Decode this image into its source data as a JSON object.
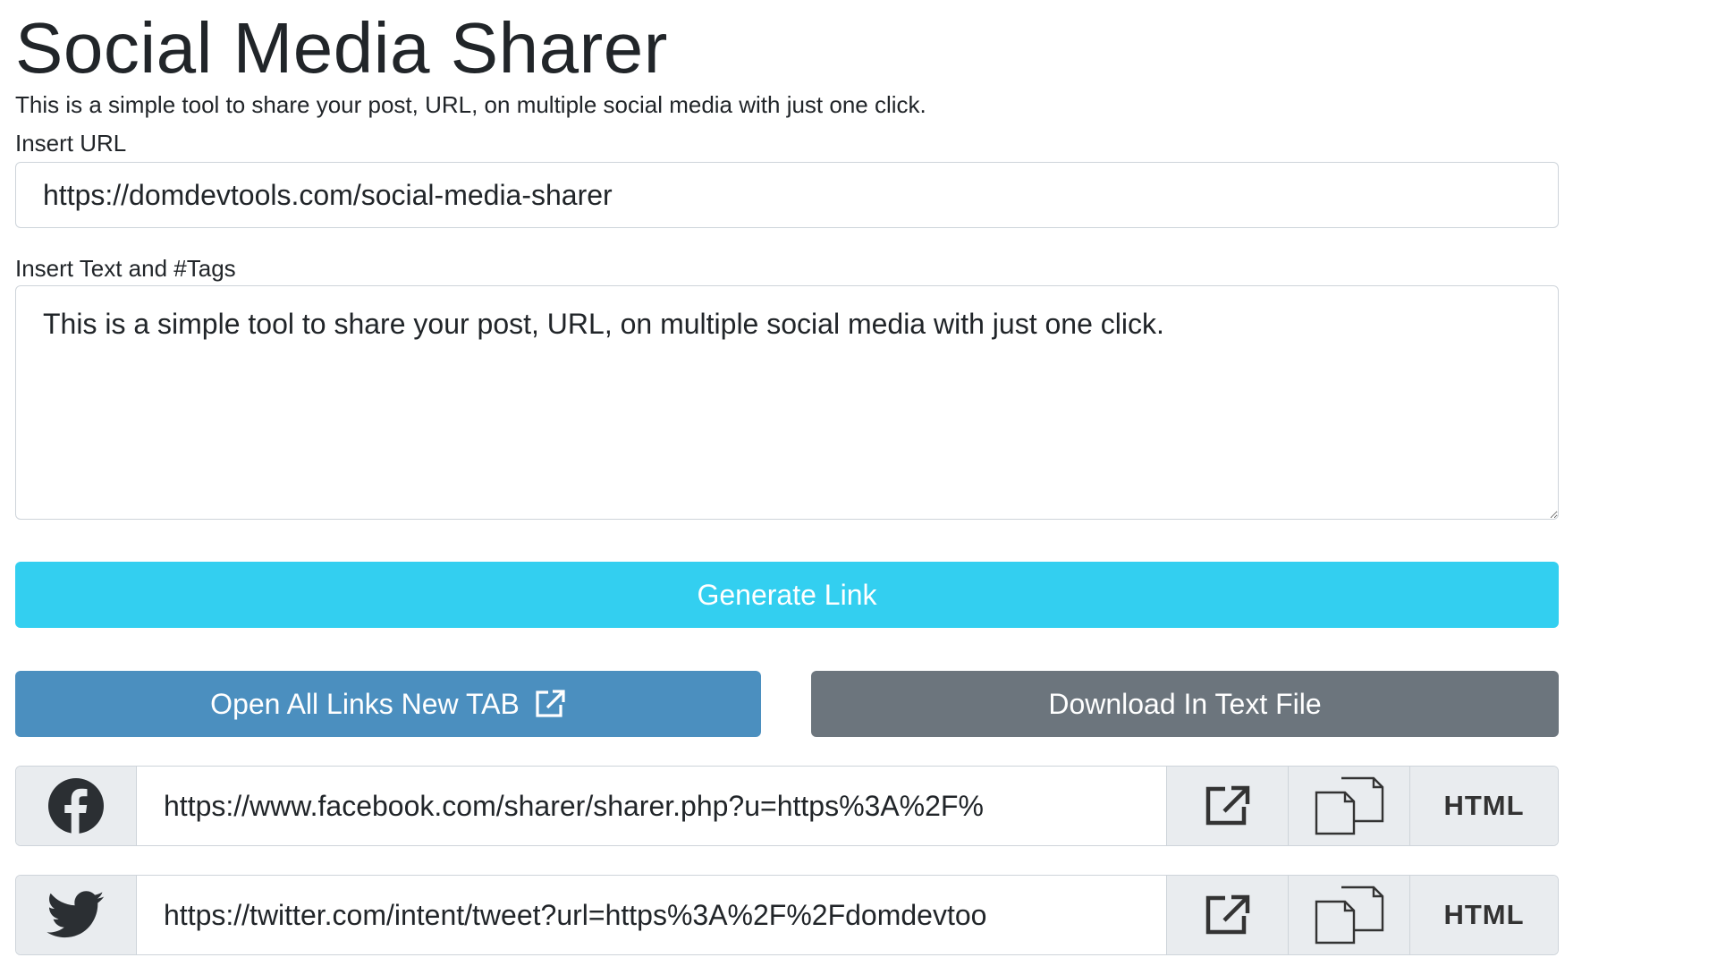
{
  "page": {
    "title": "Social Media Sharer",
    "description": "This is a simple tool to share your post, URL, on multiple social media with just one click."
  },
  "form": {
    "url_label": "Insert URL",
    "url_value": "https://domdevtools.com/social-media-sharer",
    "text_label": "Insert Text and #Tags",
    "text_value": "This is a simple tool to share your post, URL, on multiple social media with just one click."
  },
  "actions": {
    "generate_label": "Generate Link",
    "open_all_label": "Open All Links New TAB",
    "download_label": "Download In Text File"
  },
  "shares": [
    {
      "network": "facebook",
      "icon": "facebook-icon",
      "link": "https://www.facebook.com/sharer/sharer.php?u=https%3A%2F%",
      "html_label": "HTML"
    },
    {
      "network": "twitter",
      "icon": "twitter-icon",
      "link": "https://twitter.com/intent/tweet?url=https%3A%2F%2Fdomdevtoo",
      "html_label": "HTML"
    }
  ],
  "colors": {
    "generate_button": "#33cff0",
    "open_all_button": "#4b8fbf",
    "download_button": "#6c757d",
    "addon_background": "#e9ecef",
    "border": "#ced4da"
  }
}
